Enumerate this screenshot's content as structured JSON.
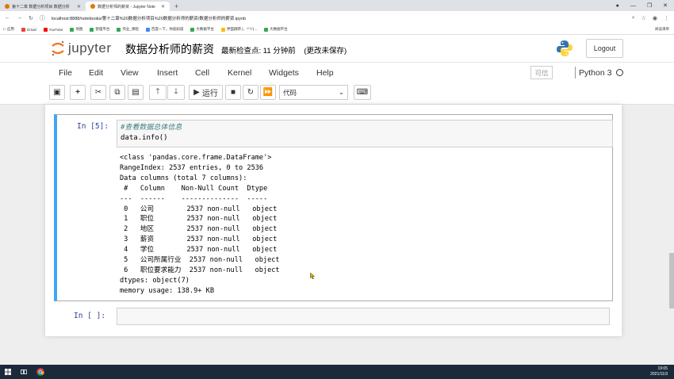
{
  "browser": {
    "tabs": [
      {
        "title": "第十二章 数据分析项目 数据分析"
      },
      {
        "title": "数据分析师的薪资 - Jupyter Note"
      }
    ],
    "url": "localhost:8888/notebooks/第十二章%20数据分析项目%20数据分析师的薪资/数据分析师的薪资.ipynb",
    "bookmarks": [
      "应用",
      "Gmail",
      "YouTube",
      "地图",
      "管理平台",
      "作业_课程",
      "百度一下，你就知道",
      "大数据平台",
      "界面跳转 (、*”ツ)...",
      "大数据平台"
    ],
    "reading_list": "阅读清单"
  },
  "header": {
    "logo_text": "jupyter",
    "notebook_title": "数据分析师的薪资",
    "checkpoint": "最新检查点: 11 分钟前",
    "unsaved": "(更改未保存)",
    "logout_label": "Logout"
  },
  "menu": {
    "items": [
      "File",
      "Edit",
      "View",
      "Insert",
      "Cell",
      "Kernel",
      "Widgets",
      "Help"
    ],
    "trusted": "可信",
    "kernel_name": "Python 3"
  },
  "toolbar": {
    "run_label": "运行",
    "cell_type": "代码"
  },
  "cells": {
    "cell1": {
      "prompt": "In  [5]:",
      "comment": "#查看数据总体信息",
      "code": "data.info()",
      "output": "<class 'pandas.core.frame.DataFrame'>\nRangeIndex: 2537 entries, 0 to 2536\nData columns (total 7 columns):\n #   Column    Non-Null Count  Dtype \n---  ------    --------------  ----- \n 0   公司        2537 non-null   object\n 1   职位        2537 non-null   object\n 2   地区        2537 non-null   object\n 3   薪资        2537 non-null   object\n 4   学位        2537 non-null   object\n 5   公司所属行业  2537 non-null   object\n 6   职位要求能力  2537 non-null   object\ndtypes: object(7)\nmemory usage: 138.9+ KB"
    },
    "cell2": {
      "prompt": "In  [ ]:"
    }
  },
  "taskbar": {
    "time": "19:05",
    "date": "2021/11/3"
  },
  "colors": {
    "selected_cell_border": "#42a5f5",
    "prompt": "#303f9f",
    "comment": "#408080",
    "taskbar": "#1b2a3a"
  }
}
